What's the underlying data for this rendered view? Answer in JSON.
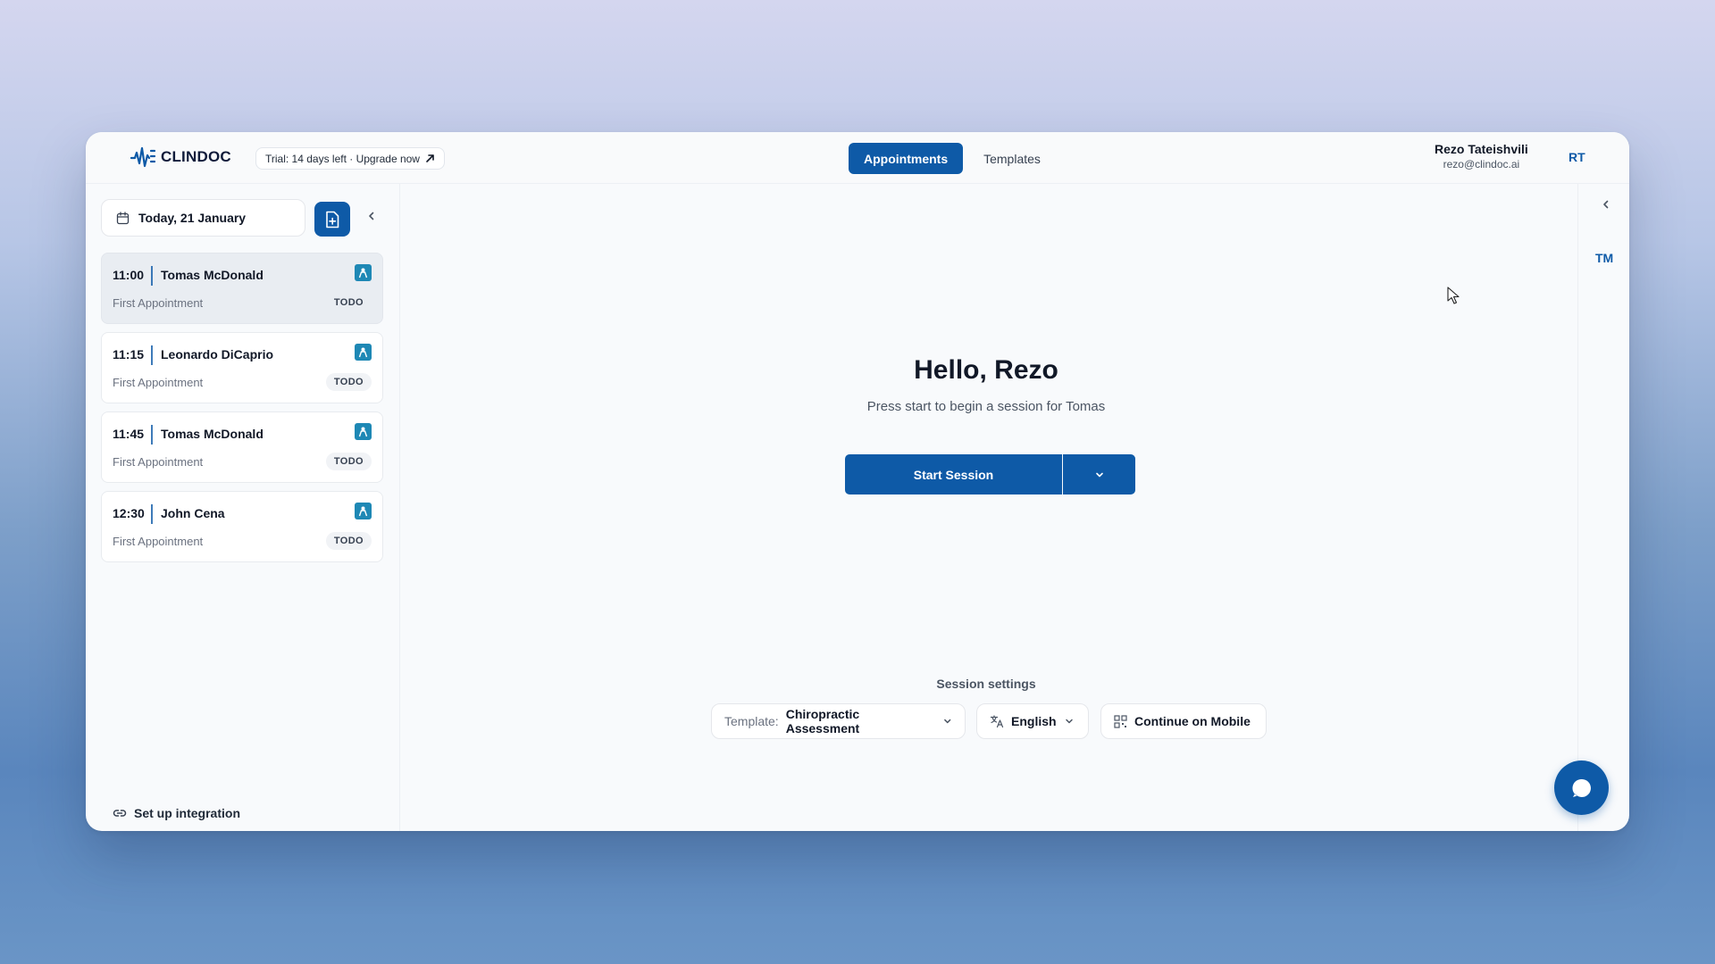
{
  "app": {
    "brand": "CLINDOC",
    "trial_text": "Trial: 14 days left · Upgrade now"
  },
  "nav": {
    "tabs": [
      {
        "label": "Appointments",
        "active": true
      },
      {
        "label": "Templates",
        "active": false
      }
    ]
  },
  "user": {
    "name": "Rezo Tateishvili",
    "email": "rezo@clindoc.ai",
    "initials": "RT"
  },
  "sidebar": {
    "date_label": "Today, 21 January",
    "appointments": [
      {
        "time": "11:00",
        "name": "Tomas McDonald",
        "type": "First Appointment",
        "status": "TODO"
      },
      {
        "time": "11:15",
        "name": "Leonardo DiCaprio",
        "type": "First Appointment",
        "status": "TODO"
      },
      {
        "time": "11:45",
        "name": "Tomas McDonald",
        "type": "First Appointment",
        "status": "TODO"
      },
      {
        "time": "12:30",
        "name": "John Cena",
        "type": "First Appointment",
        "status": "TODO"
      }
    ],
    "integration_label": "Set up integration"
  },
  "main": {
    "greeting": "Hello, Rezo",
    "subtitle": "Press start to begin a session for Tomas",
    "start_label": "Start Session",
    "settings_title": "Session settings",
    "template_label": "Template:",
    "template_value": "Chiropractic Assessment",
    "language_value": "English",
    "mobile_label": "Continue on Mobile"
  },
  "right_panel": {
    "patient_initials": "TM"
  },
  "colors": {
    "accent": "#0e5aa7",
    "appt_icon": "#1e88b5"
  },
  "icons": [
    "logo-wave-icon",
    "arrow-up-right-icon",
    "calendar-icon",
    "new-document-icon",
    "chevron-left-icon",
    "patient-icon",
    "chevron-down-icon",
    "translate-icon",
    "qr-code-icon",
    "link-icon",
    "chat-icon",
    "cursor-icon"
  ]
}
